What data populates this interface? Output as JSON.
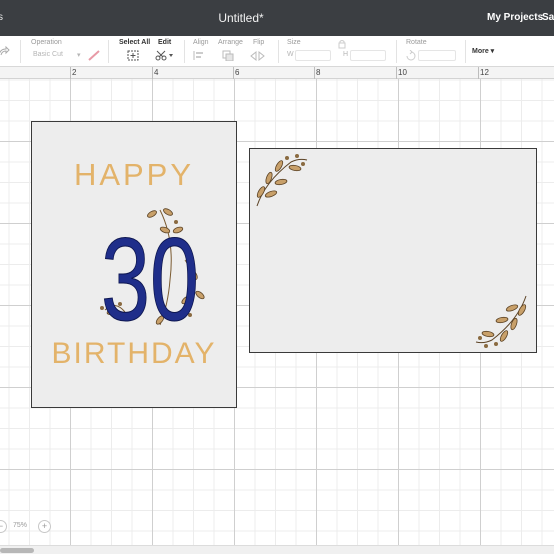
{
  "header": {
    "left_text": "s",
    "title": "Untitled*",
    "my_projects": "My Projects",
    "save": "Sav"
  },
  "toolbar": {
    "operation_label": "Operation",
    "operation_value": "Basic Cut",
    "select_all_label": "Select All",
    "edit_label": "Edit",
    "align_label": "Align",
    "arrange_label": "Arrange",
    "flip_label": "Flip",
    "size_label": "Size",
    "size_w": "W",
    "size_h": "H",
    "rotate_label": "Rotate",
    "more_label": "More ▾",
    "accent_pen_color": "#e89aa6"
  },
  "ruler": {
    "ticks": [
      "2",
      "4",
      "6",
      "8",
      "10",
      "12"
    ]
  },
  "card1": {
    "line1": "HAPPY",
    "number": "30",
    "line2": "BIRTHDAY",
    "text_color": "#e3b36a",
    "number_color": "#1f2e8a",
    "leaf_color": "#c8a06a"
  },
  "card2": {
    "leaf_color": "#c8a06a"
  },
  "bottom": {
    "zoom_minus": "−",
    "zoom_value": "75%",
    "zoom_plus": "+"
  }
}
